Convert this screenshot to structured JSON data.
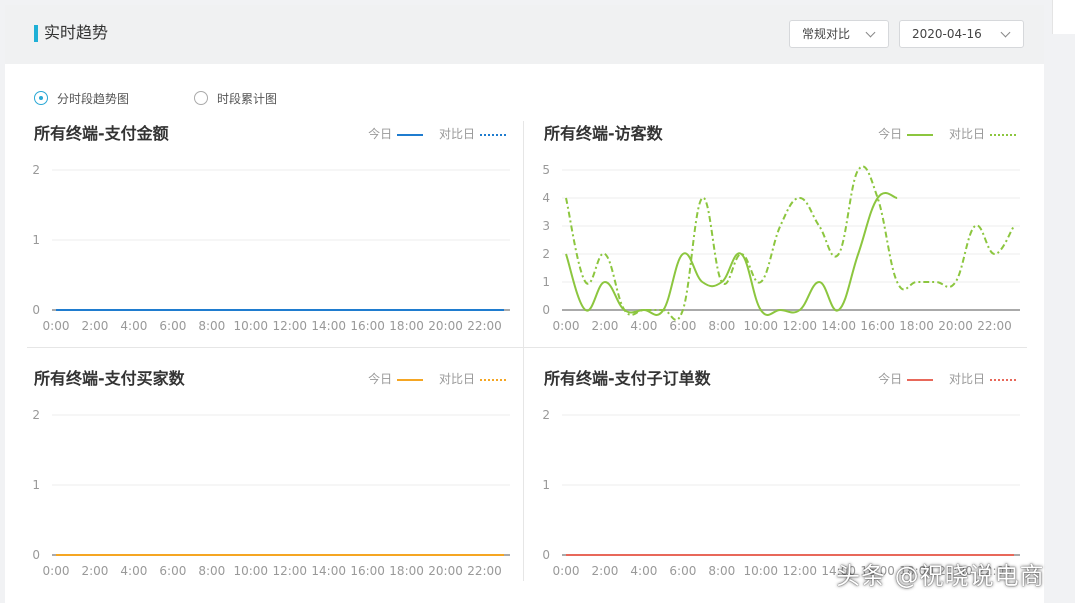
{
  "header": {
    "title": "实时趋势"
  },
  "controls": {
    "compare_mode": "常规对比",
    "date": "2020-04-16"
  },
  "view_options": [
    {
      "label": "分时段趋势图",
      "selected": true
    },
    {
      "label": "时段累计图",
      "selected": false
    }
  ],
  "legend_labels": {
    "today": "今日",
    "compare": "对比日"
  },
  "watermark": "头条 @祝晓说电商",
  "chart_data": [
    {
      "type": "line",
      "title": "所有终端-支付金额",
      "x": [
        "0:00",
        "1:00",
        "2:00",
        "3:00",
        "4:00",
        "5:00",
        "6:00",
        "7:00",
        "8:00",
        "9:00",
        "10:00",
        "11:00",
        "12:00",
        "13:00",
        "14:00",
        "15:00",
        "16:00",
        "17:00",
        "18:00",
        "19:00",
        "20:00",
        "21:00",
        "22:00",
        "23:00"
      ],
      "xticks": [
        "0:00",
        "2:00",
        "4:00",
        "6:00",
        "8:00",
        "10:00",
        "12:00",
        "14:00",
        "16:00",
        "18:00",
        "20:00",
        "22:00"
      ],
      "yticks": [
        0,
        1,
        2
      ],
      "ylim": [
        0,
        2
      ],
      "grid": true,
      "legend": "top-right",
      "series": [
        {
          "name": "今日",
          "color": "#1f7ccf",
          "dash": "solid",
          "values": [
            0,
            0,
            0,
            0,
            0,
            0,
            0,
            0,
            0,
            0,
            0,
            0,
            0,
            0,
            0,
            0,
            0,
            0,
            0,
            0,
            0,
            0,
            0,
            0
          ]
        },
        {
          "name": "对比日",
          "color": "#1f7ccf",
          "dash": "dotted",
          "values": [
            0,
            0,
            0,
            0,
            0,
            0,
            0,
            0,
            0,
            0,
            0,
            0,
            0,
            0,
            0,
            0,
            0,
            0,
            0,
            0,
            0,
            0,
            0,
            0
          ]
        }
      ]
    },
    {
      "type": "line",
      "title": "所有终端-访客数",
      "x": [
        "0:00",
        "1:00",
        "2:00",
        "3:00",
        "4:00",
        "5:00",
        "6:00",
        "7:00",
        "8:00",
        "9:00",
        "10:00",
        "11:00",
        "12:00",
        "13:00",
        "14:00",
        "15:00",
        "16:00",
        "17:00",
        "18:00",
        "19:00",
        "20:00",
        "21:00",
        "22:00",
        "23:00"
      ],
      "xticks": [
        "0:00",
        "2:00",
        "4:00",
        "6:00",
        "8:00",
        "10:00",
        "12:00",
        "14:00",
        "16:00",
        "18:00",
        "20:00",
        "22:00"
      ],
      "yticks": [
        0,
        1,
        2,
        3,
        4,
        5
      ],
      "ylim": [
        0,
        5
      ],
      "grid": true,
      "legend": "top-right",
      "series": [
        {
          "name": "今日",
          "color": "#8cc63f",
          "dash": "solid",
          "values": [
            2,
            0,
            1,
            0,
            0,
            0,
            2,
            1,
            1,
            2,
            0,
            0,
            0,
            1,
            0,
            2,
            4,
            4
          ]
        },
        {
          "name": "对比日",
          "color": "#8cc63f",
          "dash": "dashdot",
          "values": [
            4,
            1,
            2,
            0,
            0,
            0,
            0,
            4,
            1,
            2,
            1,
            3,
            4,
            3,
            2,
            5,
            4,
            1,
            1,
            1,
            1,
            3,
            2,
            3
          ]
        }
      ]
    },
    {
      "type": "line",
      "title": "所有终端-支付买家数",
      "x": [
        "0:00",
        "1:00",
        "2:00",
        "3:00",
        "4:00",
        "5:00",
        "6:00",
        "7:00",
        "8:00",
        "9:00",
        "10:00",
        "11:00",
        "12:00",
        "13:00",
        "14:00",
        "15:00",
        "16:00",
        "17:00",
        "18:00",
        "19:00",
        "20:00",
        "21:00",
        "22:00",
        "23:00"
      ],
      "xticks": [
        "0:00",
        "2:00",
        "4:00",
        "6:00",
        "8:00",
        "10:00",
        "12:00",
        "14:00",
        "16:00",
        "18:00",
        "20:00",
        "22:00"
      ],
      "yticks": [
        0,
        1,
        2
      ],
      "ylim": [
        0,
        2
      ],
      "grid": true,
      "legend": "top-right",
      "series": [
        {
          "name": "今日",
          "color": "#f5a623",
          "dash": "solid",
          "values": [
            0,
            0,
            0,
            0,
            0,
            0,
            0,
            0,
            0,
            0,
            0,
            0,
            0,
            0,
            0,
            0,
            0,
            0,
            0,
            0,
            0,
            0,
            0,
            0
          ]
        },
        {
          "name": "对比日",
          "color": "#f5a623",
          "dash": "dotted",
          "values": [
            0,
            0,
            0,
            0,
            0,
            0,
            0,
            0,
            0,
            0,
            0,
            0,
            0,
            0,
            0,
            0,
            0,
            0,
            0,
            0,
            0,
            0,
            0,
            0
          ]
        }
      ]
    },
    {
      "type": "line",
      "title": "所有终端-支付子订单数",
      "x": [
        "0:00",
        "1:00",
        "2:00",
        "3:00",
        "4:00",
        "5:00",
        "6:00",
        "7:00",
        "8:00",
        "9:00",
        "10:00",
        "11:00",
        "12:00",
        "13:00",
        "14:00",
        "15:00",
        "16:00",
        "17:00",
        "18:00",
        "19:00",
        "20:00",
        "21:00",
        "22:00",
        "23:00"
      ],
      "xticks": [
        "0:00",
        "2:00",
        "4:00",
        "6:00",
        "8:00",
        "10:00",
        "12:00",
        "14:00",
        "16:00",
        "18:00",
        "20:00",
        "22:00"
      ],
      "yticks": [
        0,
        1,
        2
      ],
      "ylim": [
        0,
        2
      ],
      "grid": true,
      "legend": "top-right",
      "series": [
        {
          "name": "今日",
          "color": "#e8685a",
          "dash": "solid",
          "values": [
            0,
            0,
            0,
            0,
            0,
            0,
            0,
            0,
            0,
            0,
            0,
            0,
            0,
            0,
            0,
            0,
            0,
            0,
            0,
            0,
            0,
            0,
            0,
            0
          ]
        },
        {
          "name": "对比日",
          "color": "#e8685a",
          "dash": "dotted",
          "values": [
            0,
            0,
            0,
            0,
            0,
            0,
            0,
            0,
            0,
            0,
            0,
            0,
            0,
            0,
            0,
            0,
            0,
            0,
            0,
            0,
            0,
            0,
            0,
            0
          ]
        }
      ]
    }
  ]
}
